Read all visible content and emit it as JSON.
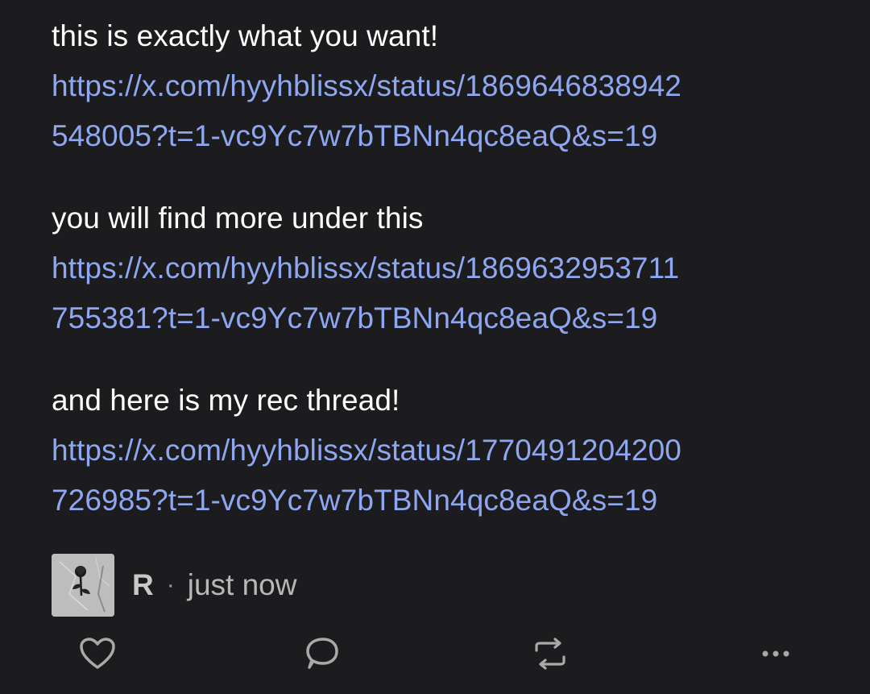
{
  "post": {
    "paragraphs": [
      {
        "text": "this is exactly what you want!",
        "link_line1": "https://x.com/hyyhblissx/status/1869646838942",
        "link_line2": "548005?t=1-vc9Yc7w7bTBNn4qc8eaQ&s=19"
      },
      {
        "text": "you will find more under this",
        "link_line1": "https://x.com/hyyhblissx/status/1869632953711",
        "link_line2": "755381?t=1-vc9Yc7w7bTBNn4qc8eaQ&s=19"
      },
      {
        "text": "and here is my rec thread!",
        "link_line1": "https://x.com/hyyhblissx/status/1770491204200",
        "link_line2": "726985?t=1-vc9Yc7w7bTBNn4qc8eaQ&s=19"
      }
    ]
  },
  "meta": {
    "author": "R",
    "separator": "·",
    "timestamp": "just now"
  },
  "actions": {
    "icons": [
      "heart-icon",
      "comment-icon",
      "repost-icon",
      "more-icon"
    ]
  },
  "colors": {
    "background": "#1c1c1e",
    "text": "#ffffff",
    "link": "#8ea7f0",
    "muted": "#b8b8b8",
    "icon": "#a9a9a9"
  }
}
